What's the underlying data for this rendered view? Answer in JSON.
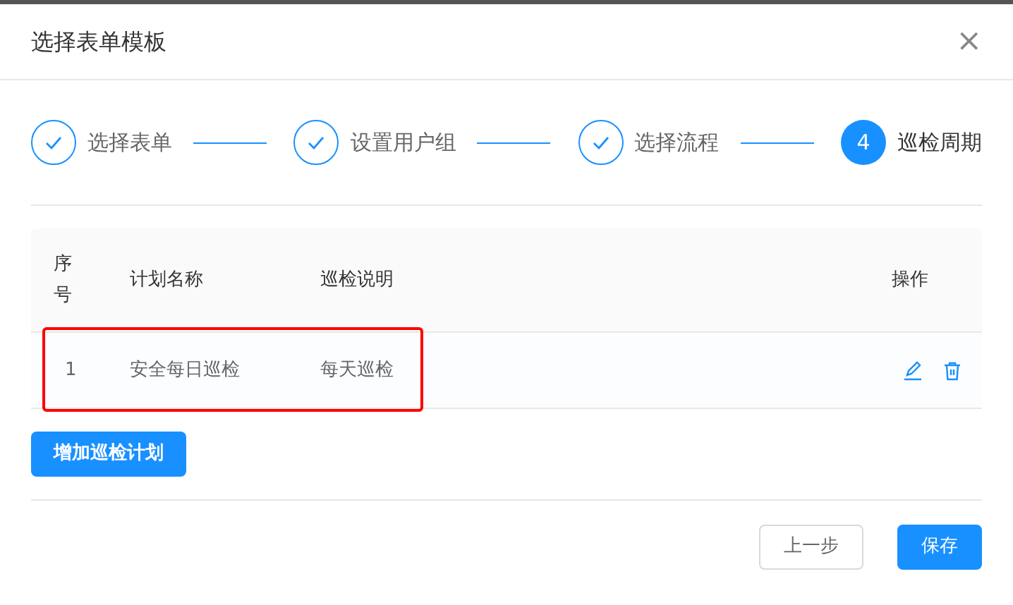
{
  "dialog": {
    "title": "选择表单模板",
    "close_label": "×"
  },
  "steps": [
    {
      "label": "选择表单",
      "done": true
    },
    {
      "label": "设置用户组",
      "done": true
    },
    {
      "label": "选择流程",
      "done": true
    },
    {
      "label": "巡检周期",
      "done": false,
      "number": "4"
    }
  ],
  "table": {
    "columns": [
      "序号",
      "计划名称",
      "巡检说明",
      "操作"
    ],
    "rows": [
      {
        "index": "1",
        "name": "安全每日巡检",
        "description": "每天巡检",
        "highlighted": true
      }
    ]
  },
  "add_button": "增加巡检计划",
  "footer": {
    "prev_button": "上一步",
    "save_button": "保存"
  }
}
